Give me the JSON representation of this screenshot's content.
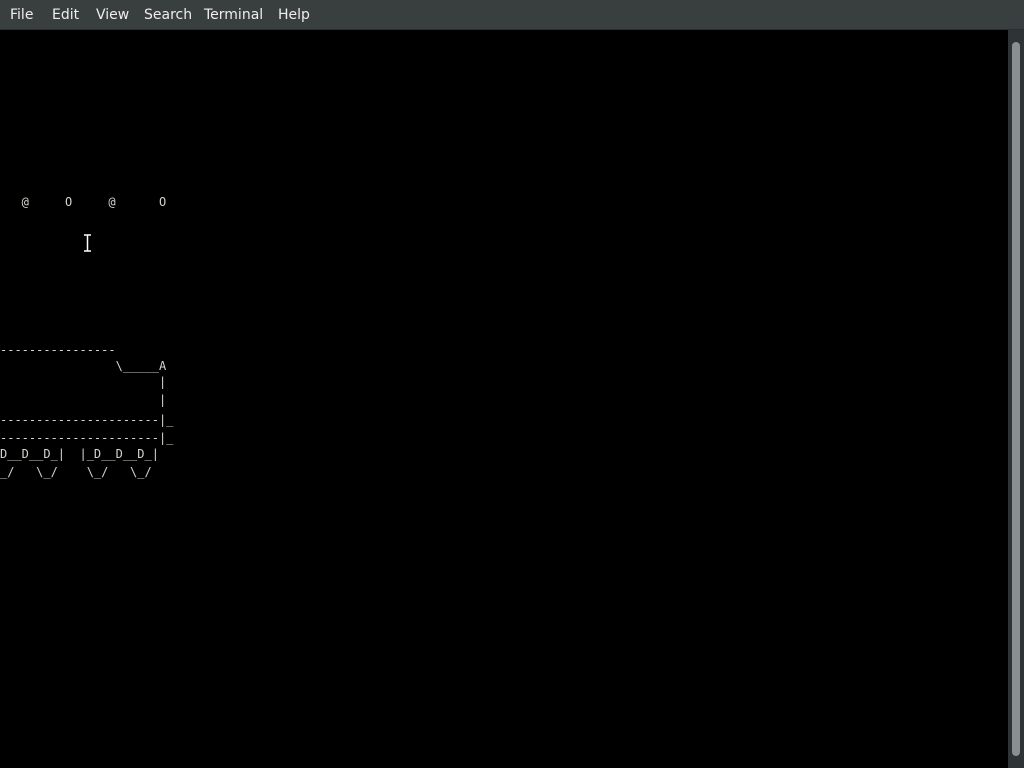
{
  "menubar": {
    "items": [
      {
        "label": "File"
      },
      {
        "label": "Edit"
      },
      {
        "label": "View"
      },
      {
        "label": "Search"
      },
      {
        "label": "Terminal"
      },
      {
        "label": "Help"
      }
    ]
  },
  "terminal": {
    "smoke_lines": [
      "   @     O     @      O"
    ],
    "train_lines": [
      "----------------",
      "                \\_____A",
      "                      |",
      "                      |",
      "----------------------|_",
      "----------------------|_",
      "D__D__D_|  |_D__D__D_|",
      "_/   \\_/    \\_/   \\_/"
    ],
    "cursor_icon": "i-beam-cursor-icon"
  },
  "colors": {
    "menubar_bg": "#393f3f",
    "menubar_text": "#eeeeec",
    "terminal_bg": "#000000",
    "terminal_text": "#d3d7cf"
  }
}
